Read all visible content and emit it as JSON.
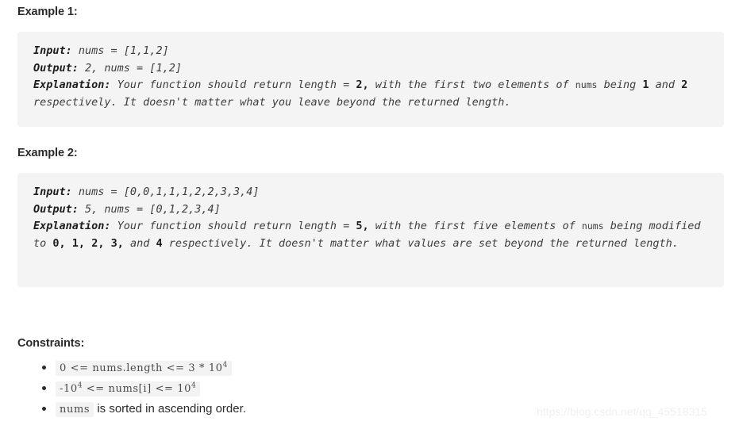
{
  "examples": [
    {
      "heading": "Example 1:",
      "input_label": "Input:",
      "input_value": " nums = [1,1,2]",
      "output_label": "Output:",
      "output_value": " 2, nums = [1,2]",
      "explanation_label": "Explanation:",
      "explanation_part1": " Your function should return length = ",
      "explanation_bold1": "2,",
      "explanation_part2": " with the first two elements of ",
      "explanation_code1": "nums",
      "explanation_part3": " being ",
      "explanation_bold2": "1",
      "explanation_part4": " and ",
      "explanation_bold3": "2",
      "explanation_part5": " respectively. It doesn't matter what you leave beyond the returned length."
    },
    {
      "heading": "Example 2:",
      "input_label": "Input:",
      "input_value": " nums = [0,0,1,1,1,2,2,3,3,4]",
      "output_label": "Output:",
      "output_value": " 5, nums = [0,1,2,3,4]",
      "explanation_label": "Explanation:",
      "explanation_part1": " Your function should return length = ",
      "explanation_bold1": "5,",
      "explanation_part2": " with the first five elements of ",
      "explanation_code1": "nums",
      "explanation_part3": " being modified to ",
      "explanation_bold2": "0,",
      "explanation_part4": " ",
      "explanation_bold3": "1,",
      "explanation_part5": " ",
      "explanation_bold4": "2,",
      "explanation_part6": " ",
      "explanation_bold5": "3,",
      "explanation_part7": " and ",
      "explanation_bold6": "4",
      "explanation_part8": " respectively. It doesn't matter what values are set beyond the returned length."
    }
  ],
  "constraints": {
    "heading": "Constraints:",
    "items": [
      {
        "code_prefix": "0 <= nums.length <= 3 * 10",
        "code_sup": "4",
        "code_suffix": "",
        "text": ""
      },
      {
        "code_prefix": "-10",
        "code_sup": "4",
        "code_mid": " <= nums[i] <= 10",
        "code_sup2": "4",
        "text": ""
      },
      {
        "code_prefix": "nums",
        "text": " is sorted in ascending order."
      }
    ]
  },
  "watermark": "https://blog.csdn.net/qq_45518315",
  "colors": {
    "page_background": "#ffffff",
    "code_block_background": "#f4f4f4",
    "code_span_background": "#f3f3f3",
    "heading_text": "#2b2b2b",
    "code_text": "#3d3d3d",
    "watermark_text": "#f0f0f0"
  }
}
